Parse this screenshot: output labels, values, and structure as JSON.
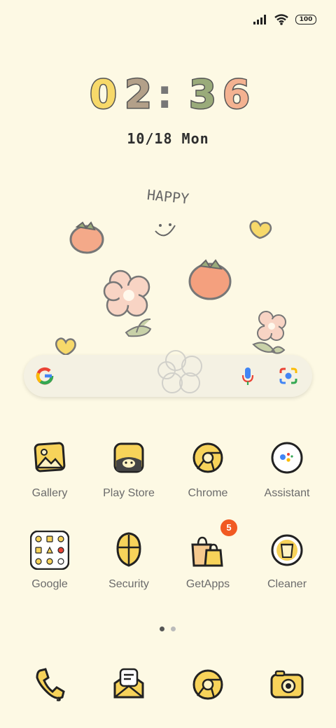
{
  "status_bar": {
    "signal_icon": "cellular-signal-icon",
    "wifi_icon": "wifi-icon",
    "battery": "100"
  },
  "clock": {
    "h1": "0",
    "h2": "2",
    "sep": ":",
    "m1": "3",
    "m2": "6"
  },
  "date": "10/18 Mon",
  "wallpaper": {
    "text": "HAPPY"
  },
  "search_bar": {
    "logo": "google-g-icon",
    "mic": "mic-icon",
    "lens": "lens-camera-icon"
  },
  "apps": [
    {
      "label": "Gallery",
      "icon": "gallery-icon"
    },
    {
      "label": "Play Store",
      "icon": "play-store-icon"
    },
    {
      "label": "Chrome",
      "icon": "chrome-icon"
    },
    {
      "label": "Assistant",
      "icon": "assistant-icon"
    },
    {
      "label": "Google",
      "icon": "google-folder-icon"
    },
    {
      "label": "Security",
      "icon": "security-icon"
    },
    {
      "label": "GetApps",
      "icon": "getapps-icon",
      "badge": "5"
    },
    {
      "label": "Cleaner",
      "icon": "cleaner-icon"
    }
  ],
  "page_indicator": {
    "pages": 2,
    "current": 1
  },
  "dock": [
    {
      "icon": "phone-icon"
    },
    {
      "icon": "messages-icon"
    },
    {
      "icon": "browser-icon"
    },
    {
      "icon": "camera-icon"
    }
  ],
  "colors": {
    "background": "#fdf9e4",
    "icon_yellow": "#f7d35a",
    "badge": "#f15a22"
  }
}
